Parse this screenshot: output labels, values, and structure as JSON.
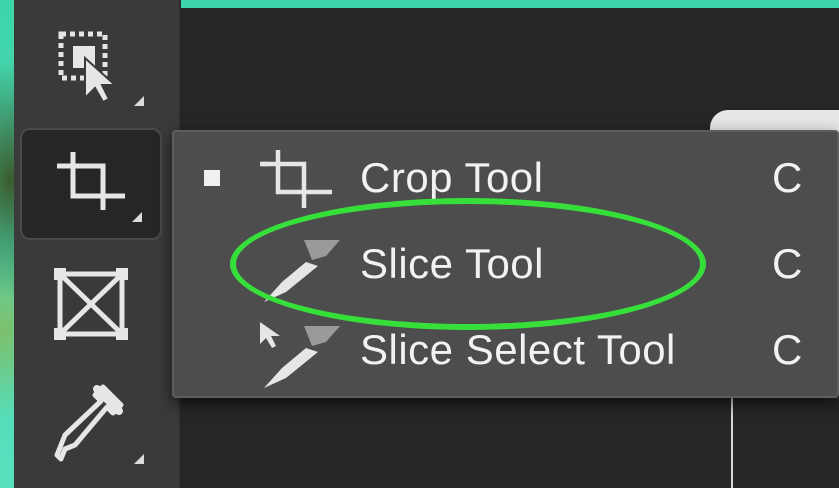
{
  "toolbar": {
    "tools": [
      {
        "icon": "artboard-select-icon"
      },
      {
        "icon": "crop-icon",
        "active": true
      },
      {
        "icon": "frame-icon"
      },
      {
        "icon": "eyedropper-icon"
      }
    ]
  },
  "flyout": {
    "items": [
      {
        "label": "Crop Tool",
        "shortcut": "C",
        "selected": true,
        "icon": "crop-icon"
      },
      {
        "label": "Slice Tool",
        "shortcut": "C",
        "selected": false,
        "icon": "slice-icon"
      },
      {
        "label": "Slice Select Tool",
        "shortcut": "C",
        "selected": false,
        "icon": "slice-select-icon"
      }
    ]
  },
  "annotation": {
    "highlight_color": "#37df3b",
    "highlighted_item": "Slice Tool"
  },
  "colors": {
    "background_teal": "#48d6b0",
    "panel": "#3a3a3a",
    "flyout": "#4d4d4d",
    "text": "#f2f2f2"
  }
}
